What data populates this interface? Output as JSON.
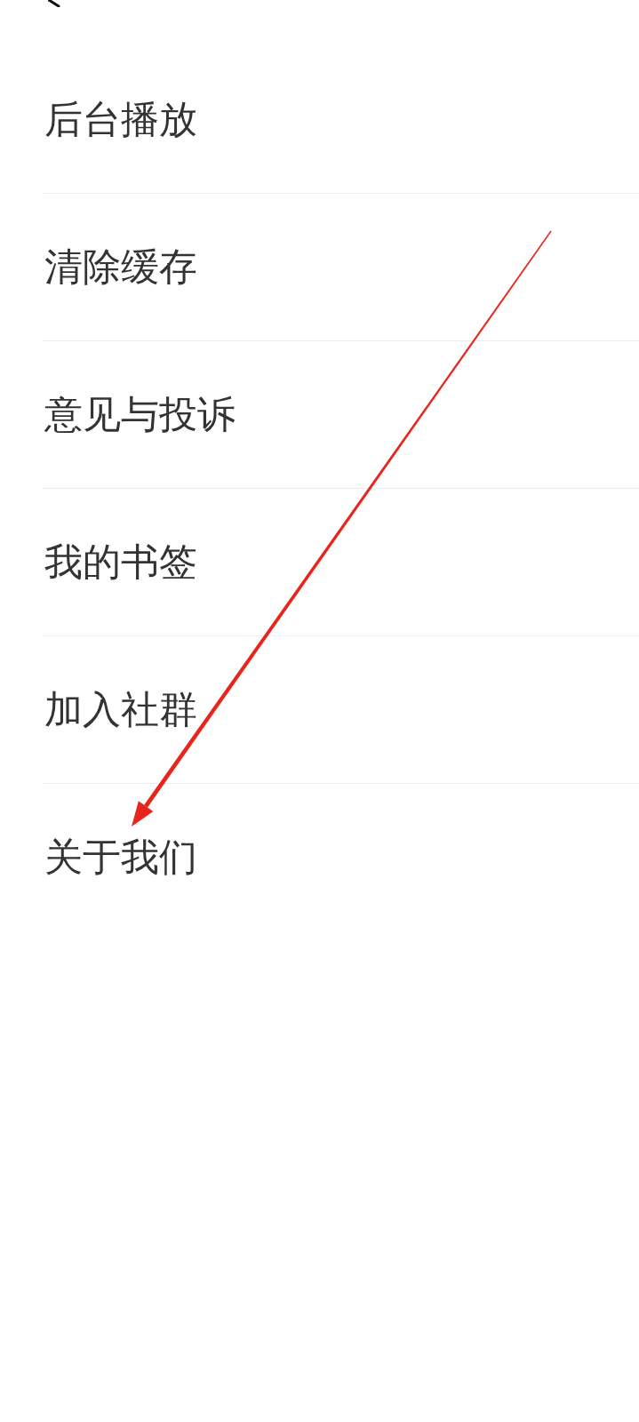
{
  "settings_items": [
    {
      "label": "后台播放"
    },
    {
      "label": "清除缓存"
    },
    {
      "label": "意见与投诉"
    },
    {
      "label": "我的书签"
    },
    {
      "label": "加入社群"
    },
    {
      "label": "关于我们"
    }
  ]
}
